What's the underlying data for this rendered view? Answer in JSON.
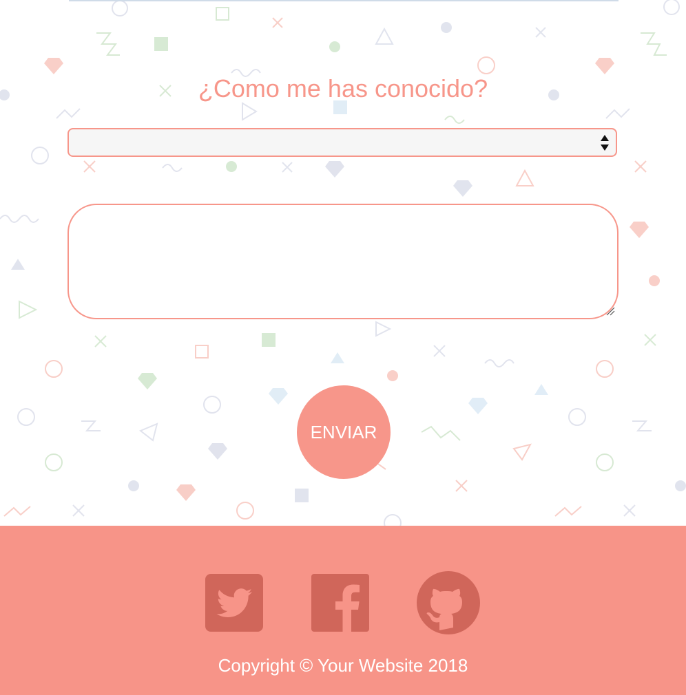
{
  "contact": {
    "heading": "¿Como me has conocido?",
    "select_value": "",
    "message_value": "",
    "submit_label": "ENVIAR"
  },
  "footer": {
    "social": [
      "twitter-icon",
      "facebook-icon",
      "github-icon"
    ],
    "copyright": "Copyright © Your Website 2018"
  },
  "colors": {
    "accent": "#f7968a",
    "footer_bg": "#f79488",
    "icon_dark": "#d0665a"
  }
}
